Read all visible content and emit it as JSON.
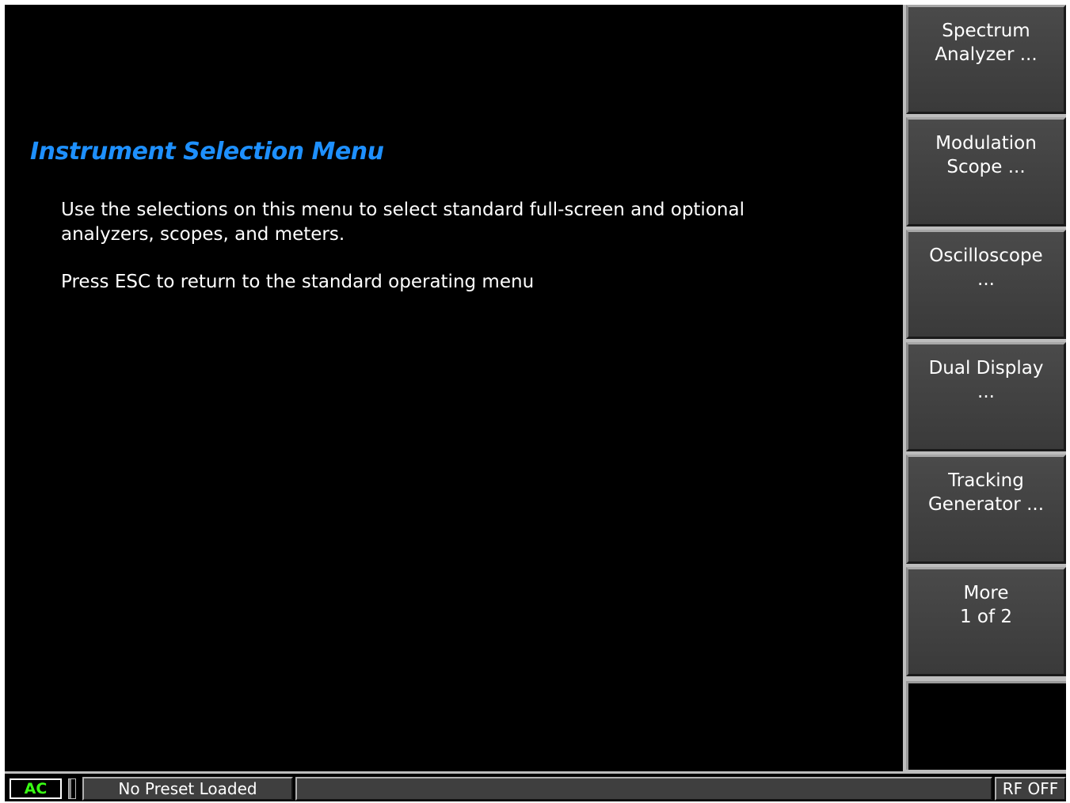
{
  "main": {
    "title": "Instrument Selection Menu",
    "description": "Use the selections on this menu to select standard full-screen and optional analyzers, scopes, and meters.",
    "escape_hint": "Press ESC to return to the standard operating menu",
    "title_color": "#1e90ff"
  },
  "softkeys": [
    {
      "label": "Spectrum\nAnalyzer ..."
    },
    {
      "label": "Modulation\nScope ..."
    },
    {
      "label": "Oscilloscope\n..."
    },
    {
      "label": "Dual Display\n..."
    },
    {
      "label": "Tracking\nGenerator ..."
    },
    {
      "label": "More\n1 of 2"
    }
  ],
  "status_bar": {
    "ac_label": "AC",
    "ac_color": "#39ff14",
    "preset_label": "No Preset Loaded",
    "message": "",
    "rf_label": "RF OFF"
  }
}
